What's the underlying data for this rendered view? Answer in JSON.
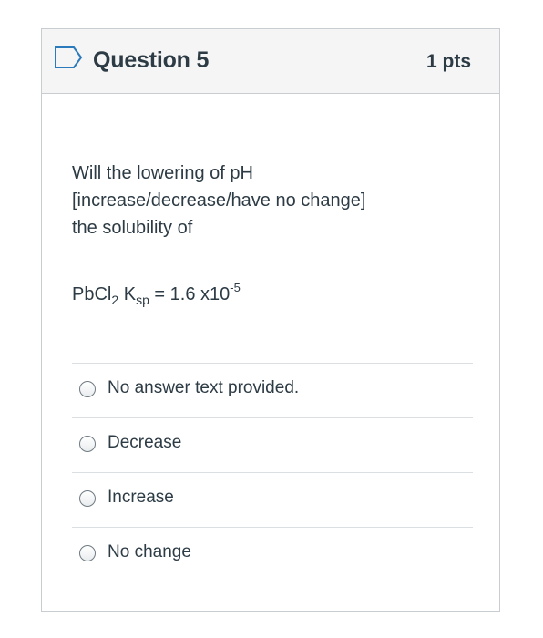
{
  "question": {
    "title": "Question 5",
    "points": "1 pts",
    "flag_icon": "flag-outline-icon",
    "text_line1": "Will the lowering of pH",
    "text_line2": "[increase/decrease/have no change]",
    "text_line3": "the solubility of",
    "formula": {
      "compound_prefix": "PbCl",
      "compound_subscript": "2",
      "k_symbol": " K",
      "k_subscript": "sp",
      "equals_value": " = 1.6 x10",
      "exponent": "-5"
    }
  },
  "answers": [
    {
      "label": "No answer text provided.",
      "selected": false
    },
    {
      "label": "Decrease",
      "selected": false
    },
    {
      "label": "Increase",
      "selected": false
    },
    {
      "label": "No change",
      "selected": false
    }
  ],
  "colors": {
    "text": "#2d3b45",
    "border": "#c7cdd1",
    "header_bg": "#f5f5f5",
    "flag": "#2b7abc"
  }
}
